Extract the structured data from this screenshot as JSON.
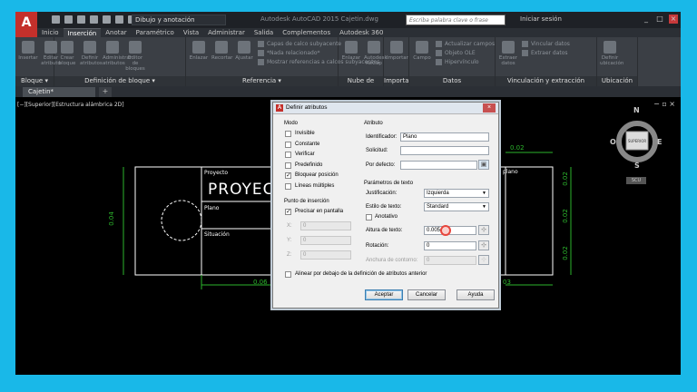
{
  "titlebar": {
    "logo": "A",
    "workspace": "Dibujo y anotación",
    "title": "Autodesk AutoCAD 2015    Cajetin.dwg",
    "search_placeholder": "Escriba palabra clave o frase",
    "signin": "Iniciar sesión"
  },
  "ribbon_tabs": [
    "Inicio",
    "Inserción",
    "Anotar",
    "Paramétrico",
    "Vista",
    "Administrar",
    "Salida",
    "Complementos",
    "Autodesk 360"
  ],
  "ribbon": {
    "panels": [
      {
        "label": "Bloque ▾",
        "buttons": [
          "Insertar",
          "Editar atributo"
        ]
      },
      {
        "label": "Definición de bloque ▾",
        "buttons": [
          "Crear bloque",
          "Definir atributos",
          "Administrar atributos",
          "Editor de bloques"
        ]
      },
      {
        "label": "Referencia ▾",
        "buttons": [
          "Enlazar",
          "Recortar",
          "Ajustar"
        ],
        "rows": [
          "Capas de calco subyacente",
          "*Nada relacionado*",
          "Mostrar referencias a calcos subyacentes"
        ]
      },
      {
        "label": "Nube de puntos",
        "buttons": [
          "Enlazar",
          "Autodesk ReCap"
        ]
      },
      {
        "label": "Importar",
        "buttons": [
          "Importar"
        ]
      },
      {
        "label": "Datos",
        "buttons": [
          "Campo"
        ],
        "rows": [
          "Actualizar campos",
          "Objeto OLE",
          "Hipervínculo"
        ]
      },
      {
        "label": "Vinculación y extracción",
        "buttons": [
          "Extraer datos"
        ],
        "rows": [
          "Vincular datos",
          "Extraer datos"
        ]
      },
      {
        "label": "Ubicación",
        "buttons": [
          "Definir ubicación"
        ]
      }
    ]
  },
  "document_tab": "Cajetin*",
  "viewport_label": "[−][Superior][Estructura alámbrica 2D]",
  "drawing": {
    "labels": {
      "proyecto": "Proyecto",
      "proyecto_big": "PROYEC",
      "plano": "Plano",
      "situacion": "Situación",
      "plano_right": "plano"
    },
    "dims": {
      "top": "0.02",
      "left": "0.04",
      "bottom": "0.06",
      "bottom_right": "03",
      "right1": "0.02",
      "right2": "0.02",
      "right3": "0.02"
    }
  },
  "viewcube": {
    "n": "N",
    "s": "S",
    "e": "E",
    "o": "O",
    "face": "SUPERIOR",
    "wcs": "SCU"
  },
  "dialog": {
    "title": "Definir atributos",
    "modo": {
      "title": "Modo",
      "options": [
        {
          "label": "Invisible",
          "checked": false
        },
        {
          "label": "Constante",
          "checked": false
        },
        {
          "label": "Verificar",
          "checked": false
        },
        {
          "label": "Predefinido",
          "checked": false
        },
        {
          "label": "Bloquear posición",
          "checked": true
        },
        {
          "label": "Líneas múltiples",
          "checked": false
        }
      ]
    },
    "insercion": {
      "title": "Punto de inserción",
      "precisar": "Precisar en pantalla",
      "x": "X:",
      "y": "Y:",
      "z": "Z:",
      "xv": "0",
      "yv": "0",
      "zv": "0"
    },
    "atributo": {
      "title": "Atributo",
      "identificador_label": "Identificador:",
      "identificador_value": "Plano",
      "solicitud_label": "Solicitud:",
      "solicitud_value": "",
      "defecto_label": "Por defecto:",
      "defecto_value": ""
    },
    "texto": {
      "title": "Parámetros de texto",
      "justificacion_label": "Justificación:",
      "justificacion_value": "Izquierda",
      "estilo_label": "Estilo de texto:",
      "estilo_value": "Standard",
      "anotativo": "Anotativo",
      "altura_label": "Altura de texto:",
      "altura_value": "0.005",
      "rotacion_label": "Rotación:",
      "rotacion_value": "0",
      "anchura_label": "Anchura de contorno:",
      "anchura_value": "0"
    },
    "alinear": "Alinear por debajo de la definición de atributos anterior",
    "buttons": {
      "aceptar": "Aceptar",
      "cancelar": "Cancelar",
      "ayuda": "Ayuda"
    }
  }
}
